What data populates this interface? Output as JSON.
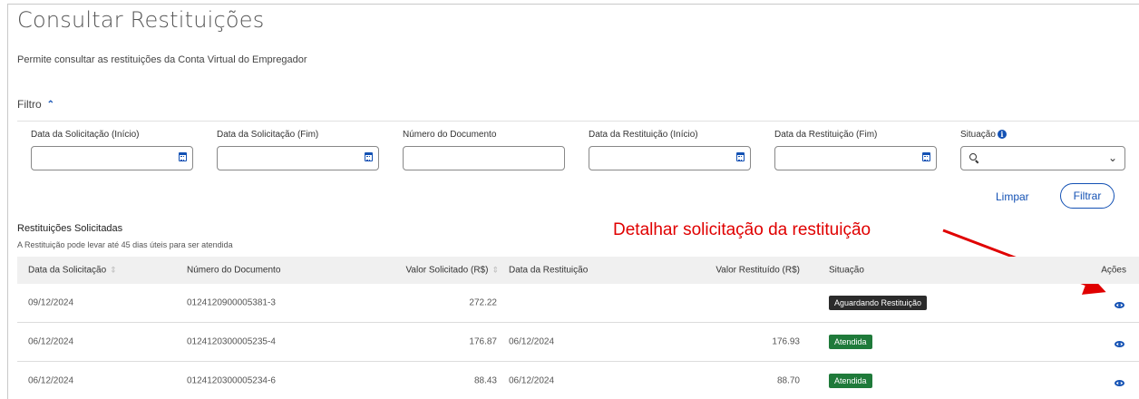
{
  "page": {
    "title": "Consultar Restituições",
    "subtitle": "Permite consultar as restituições da Conta Virtual do Empregador"
  },
  "filter": {
    "toggle_label": "Filtro",
    "fields": {
      "data_solicitacao_inicio": "Data da Solicitação (Início)",
      "data_solicitacao_fim": "Data da Solicitação (Fim)",
      "numero_documento": "Número do Documento",
      "data_restituicao_inicio": "Data da Restituição (Início)",
      "data_restituicao_fim": "Data da Restituição (Fim)",
      "situacao": "Situação"
    },
    "buttons": {
      "limpar": "Limpar",
      "filtrar": "Filtrar"
    }
  },
  "results": {
    "title": "Restituições Solicitadas",
    "note": "A Restituição pode levar até 45 dias úteis para ser atendida",
    "columns": {
      "data_solicitacao": "Data da Solicitação",
      "numero_documento": "Número do Documento",
      "valor_solicitado": "Valor Solicitado (R$)",
      "data_restituicao": "Data da Restituição",
      "valor_restituido": "Valor Restituído (R$)",
      "situacao": "Situação",
      "acoes": "Ações"
    },
    "rows": [
      {
        "data_solicitacao": "09/12/2024",
        "numero_documento": "0124120900005381-3",
        "valor_solicitado": "272.22",
        "data_restituicao": "",
        "valor_restituido": "",
        "situacao": "Aguardando Restituição"
      },
      {
        "data_solicitacao": "06/12/2024",
        "numero_documento": "0124120300005235-4",
        "valor_solicitado": "176.87",
        "data_restituicao": "06/12/2024",
        "valor_restituido": "176.93",
        "situacao": "Atendida"
      },
      {
        "data_solicitacao": "06/12/2024",
        "numero_documento": "0124120300005234-6",
        "valor_solicitado": "88.43",
        "data_restituicao": "06/12/2024",
        "valor_restituido": "88.70",
        "situacao": "Atendida"
      }
    ]
  },
  "annotation": {
    "text": "Detalhar solicitação da restituição",
    "color": "#e00000"
  },
  "colors": {
    "accent": "#1351b4",
    "status_pending": "#2b2b2b",
    "status_done": "#1f7a3a"
  },
  "icons": {
    "calendar": "calendar-icon",
    "search": "search-icon",
    "view": "eye-icon",
    "info": "info-icon"
  }
}
